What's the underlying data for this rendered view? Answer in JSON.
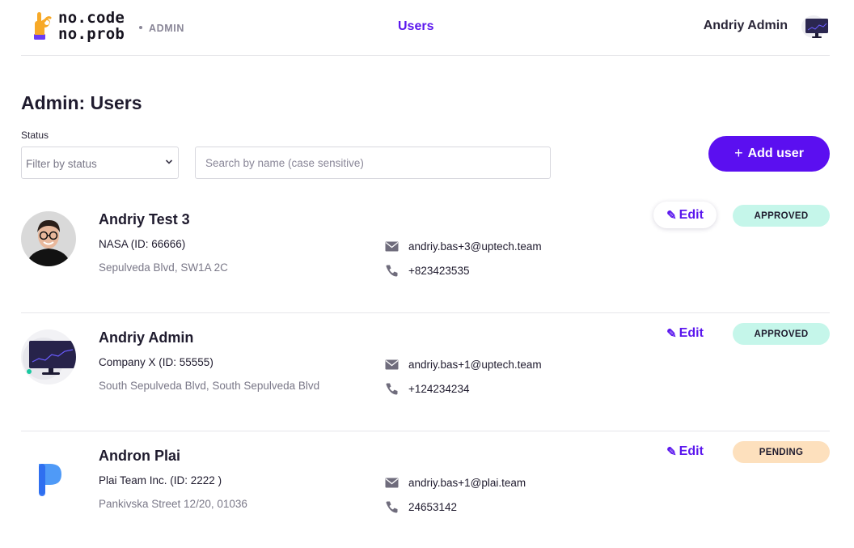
{
  "header": {
    "logo_line1": "no.code",
    "logo_line2": "no.prob",
    "admin_tag": "ADMIN",
    "nav_users": "Users",
    "current_user": "Andriy Admin"
  },
  "page": {
    "title": "Admin: Users"
  },
  "filters": {
    "status_label": "Status",
    "status_value": "Filter by status",
    "search_placeholder": "Search by name (case sensitive)",
    "add_user_label": "Add user"
  },
  "users": [
    {
      "name": "Andriy Test 3",
      "company": "NASA (ID: 66666)",
      "address": "Sepulveda Blvd, SW1A 2C",
      "email": "andriy.bas+3@uptech.team",
      "phone": "+823423535",
      "edit_label": "Edit",
      "status": "APPROVED"
    },
    {
      "name": "Andriy Admin",
      "company": "Company X (ID: 55555)",
      "address": "South Sepulveda Blvd, South Sepulveda Blvd",
      "email": "andriy.bas+1@uptech.team",
      "phone": "+124234234",
      "edit_label": "Edit",
      "status": "APPROVED"
    },
    {
      "name": "Andron Plai",
      "company": "Plai Team Inc. (ID: 2222 )",
      "address": "Pankivska Street 12/20, 01036",
      "email": "andriy.bas+1@plai.team",
      "phone": "24653142",
      "edit_label": "Edit",
      "status": "PENDING"
    }
  ],
  "colors": {
    "accent": "#5b0ff0",
    "approved": "#c5f6ea",
    "pending": "#fde0bd"
  }
}
